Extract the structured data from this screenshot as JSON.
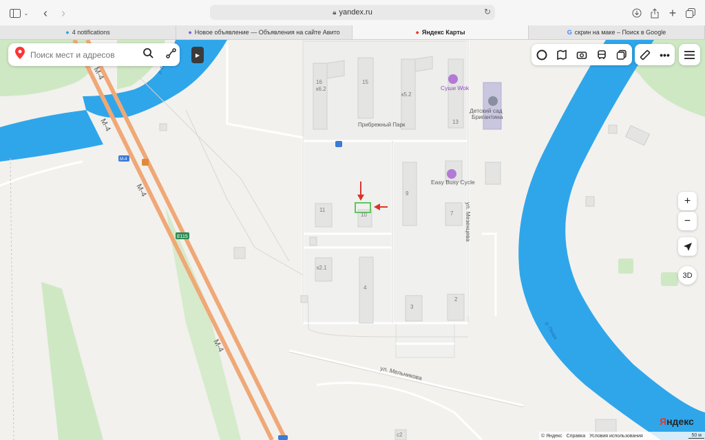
{
  "browser": {
    "address": "yandex.ru",
    "tabs": [
      {
        "label": "4 notifications",
        "icon": "telegram-icon",
        "active": false
      },
      {
        "label": "Новое объявление — Объявления на сайте Авито",
        "icon": "avito-icon",
        "active": false
      },
      {
        "label": "Яндекс Карты",
        "icon": "yandex-maps-pin-icon",
        "active": true
      },
      {
        "label": "скрин на маке – Поиск в Google",
        "icon": "google-icon",
        "active": false
      }
    ]
  },
  "search": {
    "placeholder": "Поиск мест и адресов"
  },
  "map": {
    "roads": {
      "m4_a": "M-4",
      "m4_b": "M-4",
      "m4_c": "M-4",
      "m4_d": "M-4",
      "m4_shield": "M-4",
      "e115": "E115",
      "melnikova": "ул. Мельникова",
      "mezhentseva": "ул. Мезенцева"
    },
    "rivers": {
      "upper": "р. Пахра",
      "lower": "р. Пахра"
    },
    "places": {
      "park": "Прибрежный Парк",
      "sushi": "Суши Wok",
      "kindergarten_line1": "Детский сад",
      "kindergarten_line2": "Бригантина",
      "cycle": "Easy Busy Cycle"
    },
    "buildings": {
      "b16": "16",
      "b16sub": "к6.2",
      "b15": "15",
      "b52": "к5.2",
      "b13": "13",
      "b9": "9",
      "b7": "7",
      "b11": "11",
      "b10": "10",
      "b21": "к2.1",
      "b4": "4",
      "b3": "3",
      "b2": "2",
      "bc2": "с2"
    },
    "colors": {
      "river": "#2fa6ea",
      "highway": "#f0a876",
      "park": "#cfe8c4",
      "marker": "#d9342b",
      "selection": "#5ec85e"
    }
  },
  "controls": {
    "zoom_in": "+",
    "zoom_out": "−",
    "btn_3d": "3D"
  },
  "footer": {
    "logo_y": "Я",
    "logo_rest": "ндекс",
    "copyright": "© Яндекс",
    "help": "Справка",
    "terms": "Условия использования",
    "scale": "50 м"
  }
}
